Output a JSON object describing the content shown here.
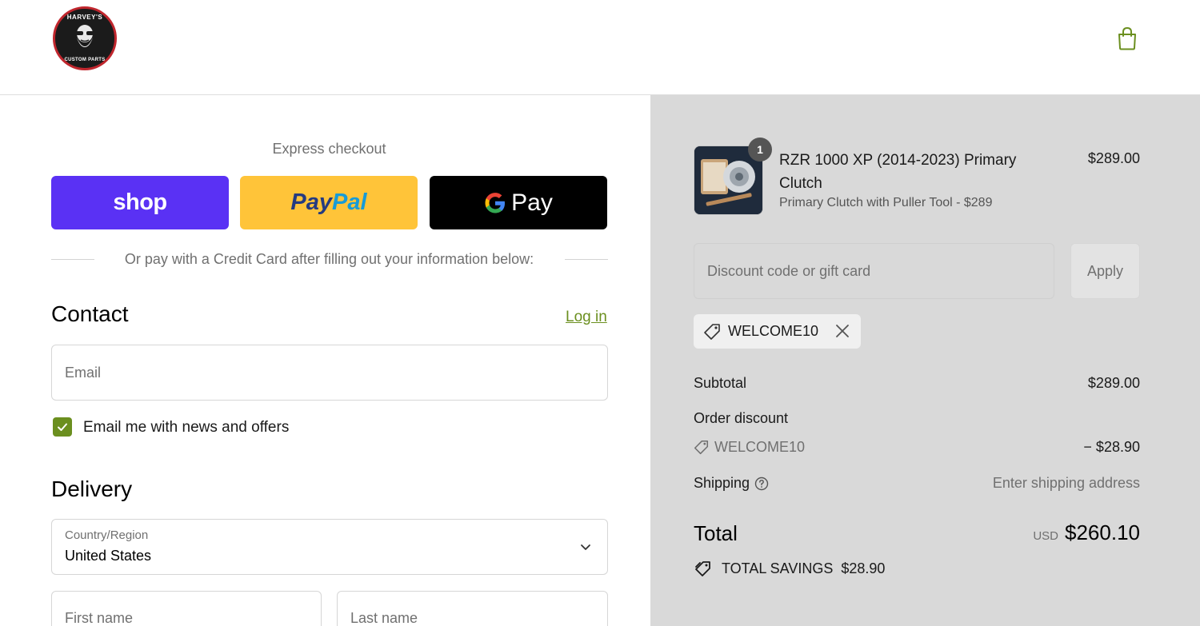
{
  "header": {
    "logo_text_top": "HARVEY'S",
    "logo_text_bottom": "CUSTOM PARTS",
    "cart_icon": "shopping-bag-icon"
  },
  "express": {
    "label": "Express checkout",
    "shop_label": "shop",
    "paypal_label_1": "Pay",
    "paypal_label_2": "Pal",
    "gpay_label": "Pay",
    "divider_text": "Or pay with a Credit Card after filling out your information below:"
  },
  "contact": {
    "title": "Contact",
    "login_label": "Log in",
    "email_placeholder": "Email",
    "newsletter_label": "Email me with news and offers",
    "newsletter_checked": true
  },
  "delivery": {
    "title": "Delivery",
    "country_label": "Country/Region",
    "country_value": "United States",
    "first_name_placeholder": "First name",
    "last_name_placeholder": "Last name"
  },
  "order": {
    "item": {
      "quantity": "1",
      "name": "RZR 1000 XP (2014-2023) Primary Clutch",
      "variant": "Primary Clutch with Puller Tool - $289",
      "price": "$289.00"
    },
    "discount_placeholder": "Discount code or gift card",
    "apply_label": "Apply",
    "applied_code": "WELCOME10",
    "subtotal_label": "Subtotal",
    "subtotal_value": "$289.00",
    "order_discount_label": "Order discount",
    "discount_code": "WELCOME10",
    "discount_value": "− $28.90",
    "shipping_label": "Shipping",
    "shipping_value": "Enter shipping address",
    "total_label": "Total",
    "total_currency": "USD",
    "total_value": "$260.10",
    "savings_label": "TOTAL SAVINGS",
    "savings_value": "$28.90"
  },
  "colors": {
    "accent": "#6b8f1f",
    "shop_purple": "#5a31f4",
    "paypal_yellow": "#ffc439",
    "summary_bg": "#d9d9d9"
  }
}
